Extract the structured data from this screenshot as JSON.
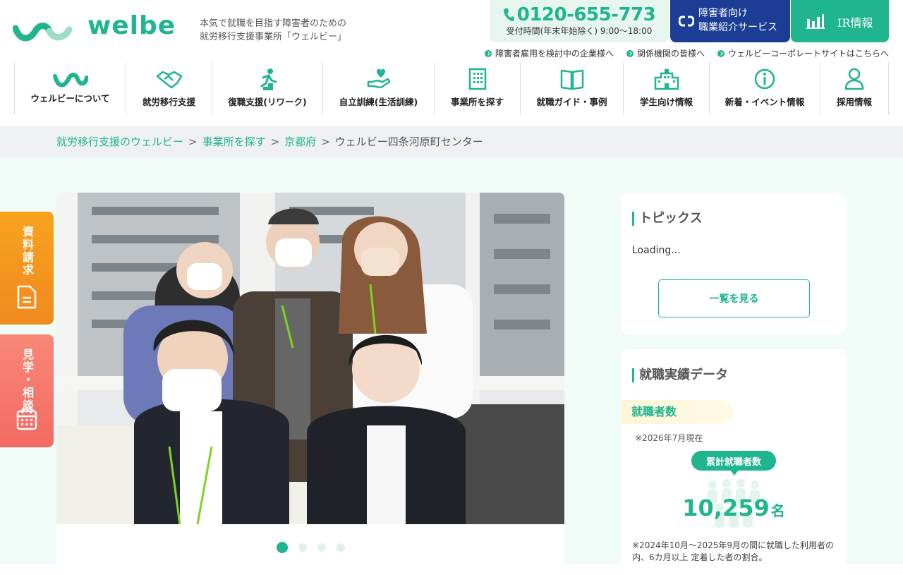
{
  "brand": {
    "logo_text": "welbe",
    "tagline_1": "本気で就職を目指す障害者のための",
    "tagline_2": "就労移行支援事業所「ウェルビー」"
  },
  "contact": {
    "phone": "0120-655-773",
    "hours": "受付時間(年末年始除く) 9:00〜18:00"
  },
  "job_service": {
    "line1": "障害者向け",
    "line2": "職業紹介サービス"
  },
  "ir": {
    "label": "IR情報"
  },
  "sub_links": [
    "障害者雇用を検討中の企業様へ",
    "関係機関の皆様へ",
    "ウェルビーコーポレートサイトはこちらへ"
  ],
  "nav": [
    {
      "label": "ウェルビーについて",
      "icon": "welbe-logo-icon"
    },
    {
      "label": "就労移行支援",
      "icon": "handshake-icon"
    },
    {
      "label": "復職支援(リワーク)",
      "icon": "climbing-stairs-icon"
    },
    {
      "label": "自立訓練(生活訓練)",
      "icon": "heart-hand-icon"
    },
    {
      "label": "事業所を探す",
      "icon": "building-icon"
    },
    {
      "label": "就職ガイド・事例",
      "icon": "book-icon"
    },
    {
      "label": "学生向け情報",
      "icon": "school-icon"
    },
    {
      "label": "新着・イベント情報",
      "icon": "info-icon"
    },
    {
      "label": "採用情報",
      "icon": "person-icon"
    }
  ],
  "breadcrumb": {
    "items": [
      "就労移行支援のウェルビー",
      "事業所を探す",
      "京都府"
    ],
    "current": "ウェルビー四条河原町センター",
    "sep": ">"
  },
  "side_tabs": {
    "request": "資料請求",
    "visit": "見学・相談"
  },
  "carousel": {
    "slides": 4,
    "active": 0
  },
  "topics": {
    "title": "トピックス",
    "loading": "Loading...",
    "more": "一覧を見る"
  },
  "employment_data": {
    "title": "就職実績データ",
    "count_label": "就職者数",
    "as_of": "※2026年7月現在",
    "pill": "累計就職者数",
    "number": "10,259",
    "unit": "名",
    "note": "※2024年10月〜2025年9月の間に就職した利用者の内、6カ月以上 定着した者の割合。"
  },
  "colors": {
    "accent": "#1fb58f",
    "navy": "#1b3d95",
    "orange": "#f7a21d",
    "coral": "#f26a62"
  }
}
